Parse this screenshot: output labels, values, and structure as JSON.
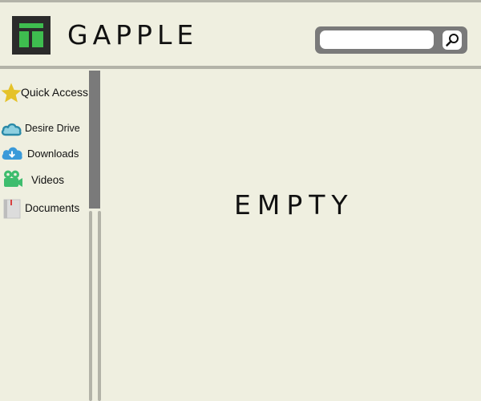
{
  "header": {
    "brand": "GAPPLE",
    "logo_icon": "window-layout-icon",
    "search": {
      "value": "",
      "placeholder": "",
      "button_icon": "magnifier-icon"
    }
  },
  "sidebar": {
    "items": [
      {
        "label": "Quick Access",
        "icon": "star-icon"
      },
      {
        "label": "Desire Drive",
        "icon": "cloud-icon"
      },
      {
        "label": "Downloads",
        "icon": "cloud-download-icon"
      },
      {
        "label": "Videos",
        "icon": "video-camera-icon"
      },
      {
        "label": "Documents",
        "icon": "document-icon"
      }
    ]
  },
  "main": {
    "empty_message": "EMPTY"
  },
  "colors": {
    "background": "#efefe0",
    "rule": "#b3b3a8",
    "logo_bg": "#2b2b2b",
    "logo_accent": "#3ebd4f",
    "search_frame": "#7a7a7a",
    "scrollbar": "#7a7a7a",
    "star": "#e5c229",
    "cloud": "#2b8aa8",
    "download_cloud": "#3a9ad9",
    "video": "#3ebd6e"
  }
}
